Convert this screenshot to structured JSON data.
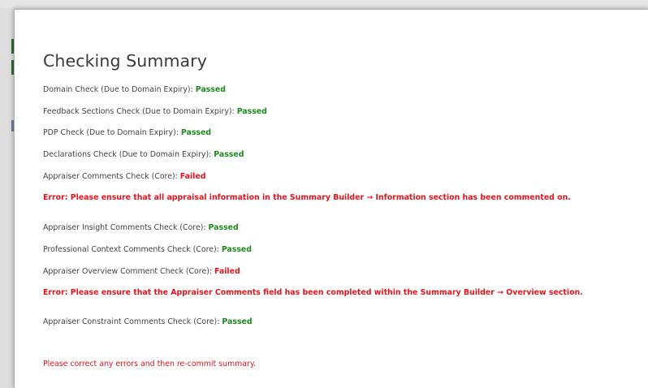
{
  "dialog": {
    "title": "Checking Summary",
    "checks": [
      {
        "label": "Domain Check (Due to Domain Expiry):",
        "status": "Passed"
      },
      {
        "label": "Feedback Sections Check (Due to Domain Expiry):",
        "status": "Passed"
      },
      {
        "label": "PDP Check (Due to Domain Expiry):",
        "status": "Passed"
      },
      {
        "label": "Declarations Check (Due to Domain Expiry):",
        "status": "Passed"
      },
      {
        "label": "Appraiser Comments Check (Core):",
        "status": "Failed"
      },
      {
        "label": "Appraiser Insight Comments Check (Core):",
        "status": "Passed"
      },
      {
        "label": "Professional Context Comments Check (Core):",
        "status": "Passed"
      },
      {
        "label": "Appraiser Overview Comment Check (Core):",
        "status": "Failed"
      },
      {
        "label": "Appraiser Constraint Comments Check (Core):",
        "status": "Passed"
      }
    ],
    "errors": [
      "Error: Please ensure that all appraisal information in the Summary Builder → Information section has been commented on.",
      "Error: Please ensure that the Appraiser Comments field has been completed within the Summary Builder → Overview section."
    ],
    "footer_message": "Please correct any errors and then re-commit summary."
  },
  "colors": {
    "passed": "#1b8a1b",
    "failed": "#e8131a",
    "text": "#444444",
    "title": "#3a3a3a"
  }
}
